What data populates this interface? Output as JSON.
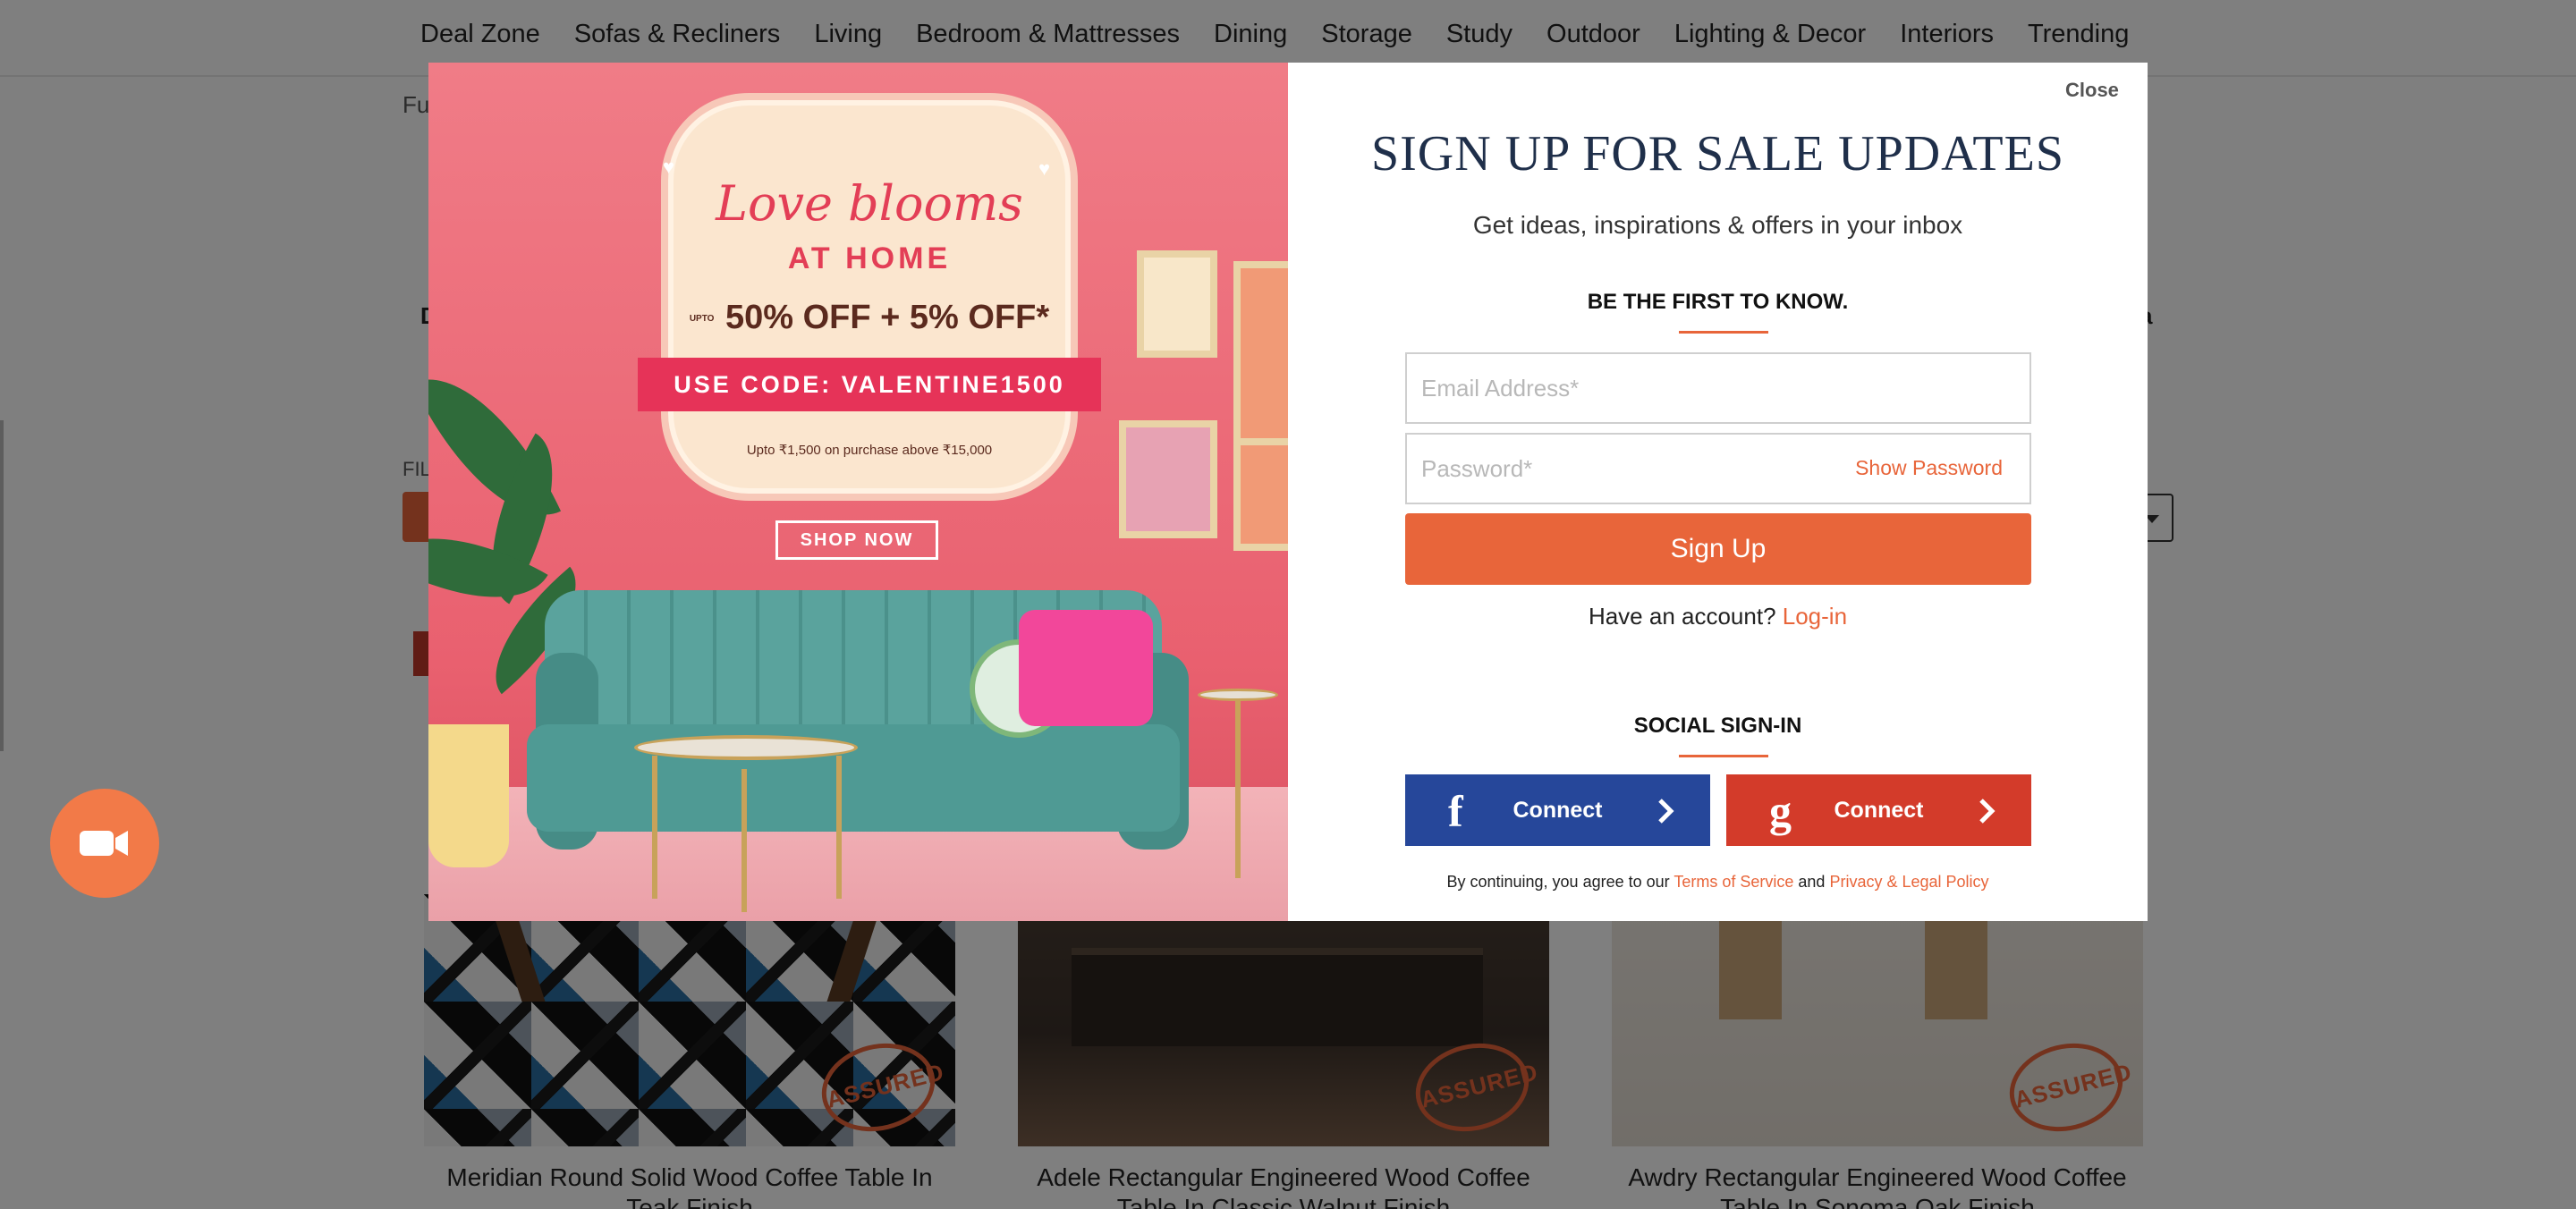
{
  "nav": {
    "items": [
      "Deal Zone",
      "Sofas & Recliners",
      "Living",
      "Bedroom & Mattresses",
      "Dining",
      "Storage",
      "Study",
      "Outdoor",
      "Lighting & Decor",
      "Interiors",
      "Trending"
    ]
  },
  "background": {
    "breadcrumb_partial": "Fu",
    "filter_partial": "FIL",
    "d_partial": "D",
    "a_partial": "a",
    "products": [
      {
        "title": "Meridian Round Solid Wood Coffee Table In Teak Finish",
        "badge": "ASSURED"
      },
      {
        "title": "Adele Rectangular Engineered Wood Coffee Table In Classic Walnut Finish",
        "badge": "ASSURED"
      },
      {
        "title": "Awdry Rectangular Engineered Wood Coffee Table In Sonoma Oak Finish",
        "badge": "ASSURED"
      }
    ]
  },
  "video_button": {
    "icon": "video-camera-icon"
  },
  "promo": {
    "script_title": "Love blooms",
    "sub_title": "AT HOME",
    "offer_prefix": "UPTO",
    "offer": "50% OFF + 5% OFF*",
    "code_label": "USE CODE: VALENTINE1500",
    "fine_print": "Upto ₹1,500 on purchase above ₹15,000",
    "cta": "SHOP NOW"
  },
  "modal": {
    "close_label": "Close",
    "headline": "SIGN UP FOR SALE UPDATES",
    "subline": "Get ideas, inspirations & offers in your inbox",
    "first_know": "BE THE FIRST TO KNOW.",
    "email_placeholder": "Email Address*",
    "password_placeholder": "Password*",
    "show_password": "Show Password",
    "signup_label": "Sign Up",
    "have_account": "Have an account?",
    "login_link": "Log-in",
    "social_title": "SOCIAL SIGN-IN",
    "facebook": {
      "glyph": "f",
      "label": "Connect"
    },
    "google": {
      "glyph": "g",
      "label": "Connect"
    },
    "terms_prefix": "By continuing, you agree to our",
    "terms_link": "Terms of Service",
    "terms_and": "and",
    "privacy_link": "Privacy & Legal Policy"
  },
  "colors": {
    "accent": "#e8653a",
    "headline": "#1f2f4a",
    "facebook": "#26479a",
    "google": "#d33b2a",
    "overlay": "rgba(0,0,0,0.5)"
  }
}
